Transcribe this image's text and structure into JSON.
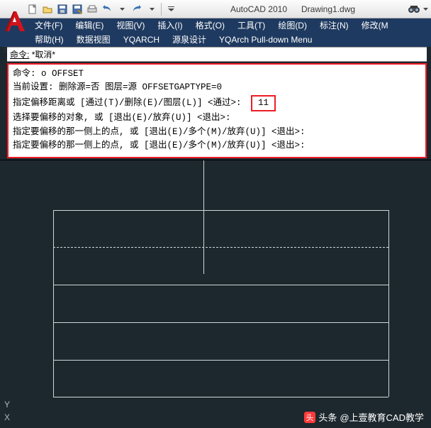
{
  "title_bar": {
    "app_name": "AutoCAD 2010",
    "document": "Drawing1.dwg"
  },
  "menus": {
    "row1": [
      {
        "label": "文件(F)"
      },
      {
        "label": "编辑(E)"
      },
      {
        "label": "视图(V)"
      },
      {
        "label": "插入(I)"
      },
      {
        "label": "格式(O)"
      },
      {
        "label": "工具(T)"
      },
      {
        "label": "绘图(D)"
      },
      {
        "label": "标注(N)"
      },
      {
        "label": "修改(M"
      }
    ],
    "row2": [
      {
        "label": "帮助(H)"
      },
      {
        "label": "数据视图"
      },
      {
        "label": "YQARCH"
      },
      {
        "label": "源泉设计"
      },
      {
        "label": "YQArch Pull-down Menu"
      }
    ]
  },
  "cmd_history": {
    "cancel_prefix": "命令:",
    "cancel_text": "*取消*"
  },
  "cmd_lines": {
    "l1": "命令: o OFFSET",
    "l2": "当前设置: 删除源=否  图层=源  OFFSETGAPTYPE=0",
    "l3_pre": "指定偏移距离或 [通过(T)/删除(E)/图层(L)] <通过>:",
    "l3_val": "11",
    "l4": "选择要偏移的对象, 或 [退出(E)/放弃(U)] <退出>:",
    "l5": "指定要偏移的那一侧上的点, 或 [退出(E)/多个(M)/放弃(U)] <退出>:",
    "l6": "指定要偏移的那一侧上的点, 或 [退出(E)/多个(M)/放弃(U)] <退出>:"
  },
  "axes": {
    "y": "Y",
    "x": "X"
  },
  "watermark": {
    "prefix": "头条",
    "text": "@上壹教育CAD教学"
  },
  "qat_icons": {
    "new": "new-icon",
    "open": "open-icon",
    "save": "save-icon",
    "saveas": "saveas-icon",
    "plot": "plot-icon",
    "undo": "undo-icon",
    "redo": "redo-icon",
    "binoculars": "binoculars-icon"
  }
}
